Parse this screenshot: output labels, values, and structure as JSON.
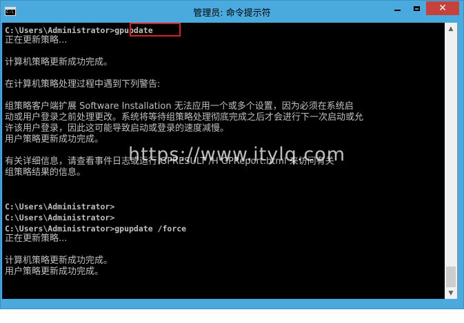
{
  "window": {
    "title": "管理员: 命令提示符",
    "icon": "cmd-icon",
    "icon_text": "C:\\_",
    "controls": {
      "minimize": "minimize-icon",
      "maximize": "maximize-icon",
      "close_symbol": "✕"
    }
  },
  "console": {
    "lines": [
      "C:\\Users\\Administrator>gpupdate",
      "正在更新策略...",
      "",
      "计算机策略更新成功完成。",
      "",
      "在计算机策略处理过程中遇到下列警告:",
      "",
      "组策略客户端扩展 Software Installation 无法应用一个或多个设置，因为必须在系统启",
      "动或用户登录之前处理更改。系统将等待组策略处理彻底完成之后才会进行下一次启动或允",
      "许该用户登录，因此这可能导致启动或登录的速度减慢。",
      "用户策略更新成功完成。",
      "",
      "有关详细信息，请查看事件日志或运行 GPRESULT /H GPReport.html 来访问有关",
      "组策略结果的信息。",
      "",
      "",
      "C:\\Users\\Administrator>",
      "C:\\Users\\Administrator>",
      "C:\\Users\\Administrator>gpupdate /force",
      "正在更新策略...",
      "",
      "计算机策略更新成功完成。",
      "用户策略更新成功完成。"
    ]
  },
  "watermark": "https://www.itylq.com",
  "colors": {
    "titlebar": "#4aa9dd",
    "console_bg": "#000000",
    "console_fg": "#c0c0c0",
    "highlight": "#e02020",
    "close_button": "#c7413d"
  }
}
